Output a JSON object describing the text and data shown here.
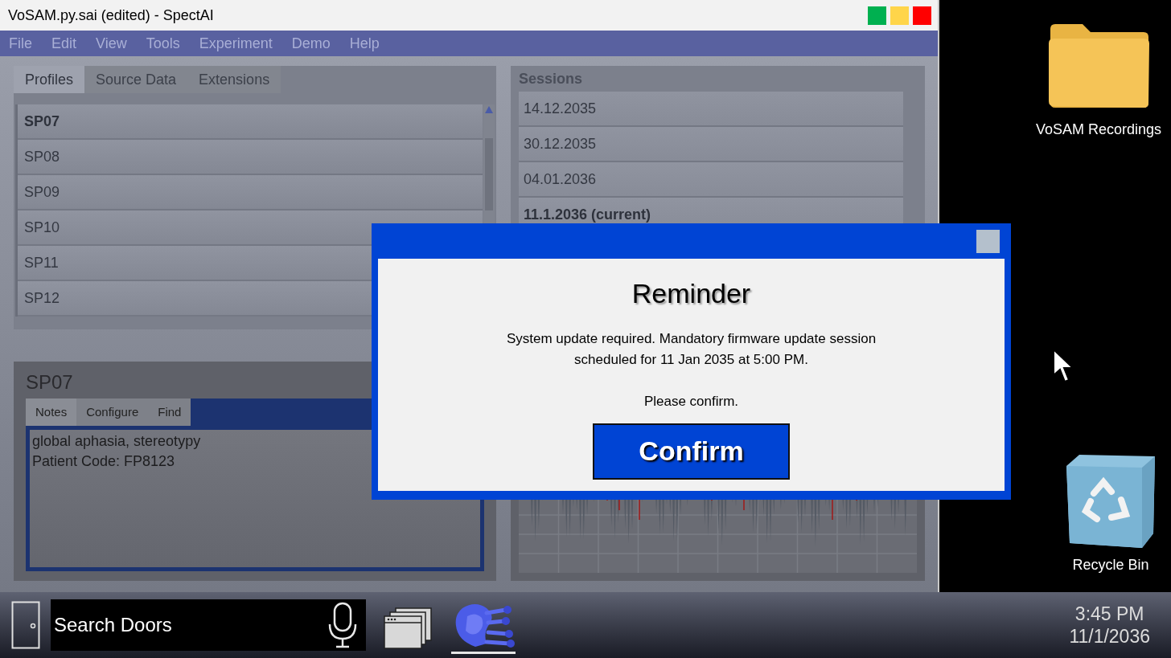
{
  "window": {
    "title": "VoSAM.py.sai (edited) - SpectAI",
    "controls": [
      {
        "color": "#00b050"
      },
      {
        "color": "#ffd54a"
      },
      {
        "color": "#ff0000"
      }
    ]
  },
  "menu": [
    "File",
    "Edit",
    "View",
    "Tools",
    "Experiment",
    "Demo",
    "Help"
  ],
  "profile_tabs": [
    {
      "label": "Profiles",
      "selected": true
    },
    {
      "label": "Source Data",
      "selected": false
    },
    {
      "label": "Extensions",
      "selected": false
    }
  ],
  "profiles": [
    {
      "label": "SP07",
      "selected": true
    },
    {
      "label": "SP08",
      "selected": false
    },
    {
      "label": "SP09",
      "selected": false
    },
    {
      "label": "SP10",
      "selected": false
    },
    {
      "label": "SP11",
      "selected": false
    },
    {
      "label": "SP12",
      "selected": false
    }
  ],
  "sessions": {
    "title": "Sessions",
    "items": [
      {
        "label": "14.12.2035",
        "selected": false
      },
      {
        "label": "30.12.2035",
        "selected": false
      },
      {
        "label": "04.01.2036",
        "selected": false
      },
      {
        "label": "11.1.2036 (current)",
        "selected": true
      }
    ]
  },
  "detail": {
    "title": "SP07",
    "tabs": [
      {
        "label": "Notes",
        "selected": true
      },
      {
        "label": "Configure",
        "selected": false
      },
      {
        "label": "Find",
        "selected": false
      }
    ],
    "notes": [
      "global aphasia, stereotypy",
      "Patient Code: FP8123"
    ]
  },
  "dialog": {
    "title": "Reminder",
    "message": "System update required. Mandatory firmware update session scheduled for 11 Jan 2035 at 5:00 PM.",
    "prompt": "Please confirm.",
    "button": "Confirm"
  },
  "desktop_icons": [
    {
      "kind": "folder",
      "label": "VoSAM Recordings"
    },
    {
      "kind": "recycle",
      "label": "Recycle Bin"
    }
  ],
  "taskbar": {
    "search": {
      "placeholder": "Search Doors"
    },
    "apps": [
      {
        "kind": "windows",
        "selected": false
      },
      {
        "kind": "logo",
        "selected": true
      }
    ],
    "time": "3:45 PM",
    "date": "11/1/2036"
  }
}
